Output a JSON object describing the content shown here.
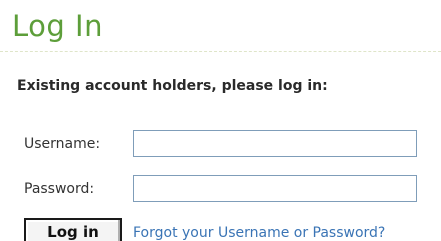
{
  "page": {
    "title": "Log In"
  },
  "login_form": {
    "heading": "Existing account holders, please log in:",
    "username_label": "Username:",
    "username_value": "",
    "password_label": "Password:",
    "password_value": "",
    "submit_label": "Log in",
    "forgot_link_label": "Forgot your Username or Password?"
  },
  "colors": {
    "title": "#5d9e3a",
    "link": "#3a74b5",
    "input_border": "#7f9db9"
  }
}
